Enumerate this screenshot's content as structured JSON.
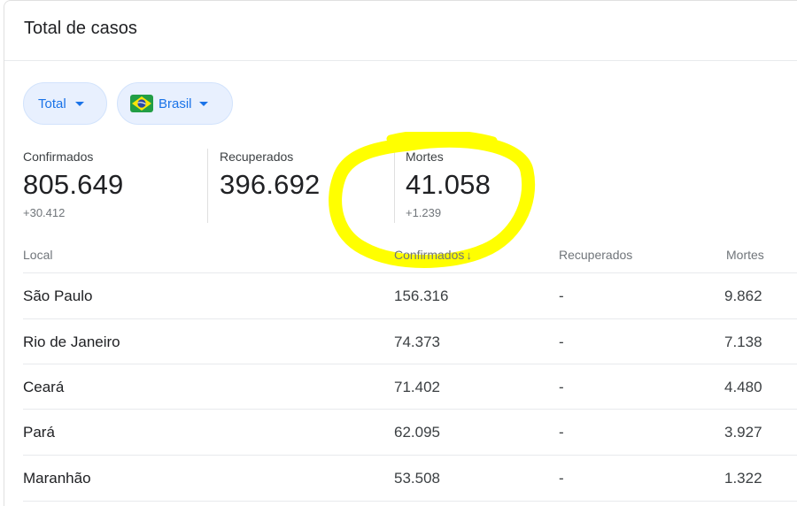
{
  "card": {
    "title": "Total de casos"
  },
  "filters": {
    "scope_label": "Total",
    "region_label": "Brasil"
  },
  "stats": {
    "confirmados": {
      "label": "Confirmados",
      "value": "805.649",
      "delta": "+30.412"
    },
    "recuperados": {
      "label": "Recuperados",
      "value": "396.692"
    },
    "mortes": {
      "label": "Mortes",
      "value": "41.058",
      "delta": "+1.239"
    }
  },
  "table": {
    "headers": {
      "local": "Local",
      "confirmados": "Confirmados",
      "sort_arrow": "↓",
      "recuperados": "Recuperados",
      "mortes": "Mortes"
    },
    "rows": [
      {
        "local": "São Paulo",
        "confirmados": "156.316",
        "recuperados": "-",
        "mortes": "9.862"
      },
      {
        "local": "Rio de Janeiro",
        "confirmados": "74.373",
        "recuperados": "-",
        "mortes": "7.138"
      },
      {
        "local": "Ceará",
        "confirmados": "71.402",
        "recuperados": "-",
        "mortes": "4.480"
      },
      {
        "local": "Pará",
        "confirmados": "62.095",
        "recuperados": "-",
        "mortes": "3.927"
      },
      {
        "local": "Maranhão",
        "confirmados": "53.508",
        "recuperados": "-",
        "mortes": "1.322"
      }
    ]
  },
  "colors": {
    "accent": "#1a73e8",
    "chip_bg": "#e8f0fe",
    "highlight": "#ffff00",
    "muted_text": "#70757a"
  },
  "icons": {
    "dropdown": "caret-down-icon",
    "flag": "brazil-flag-icon",
    "sort": "arrow-down-icon"
  }
}
